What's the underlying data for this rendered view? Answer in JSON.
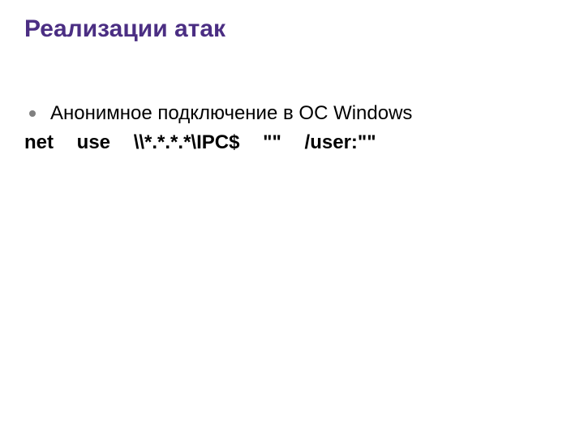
{
  "title": "Реализации атак",
  "bullet1": "Анонимное подключение в ОС Windows",
  "cmd": {
    "p1": "net",
    "p2": "use",
    "p3": "\\\\*.*.*.*\\IPC$",
    "p4": "\"\"",
    "p5": "/user:\"\""
  }
}
